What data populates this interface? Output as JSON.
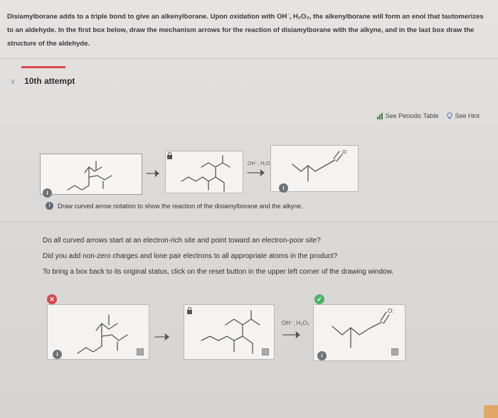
{
  "question": {
    "lead": "Disiamylborane adds to a triple bond to give an alkenylborane. Upon oxidation with OH",
    "sup": "−",
    "mid": ", H₂O₂, the alkenylborane will form an enol that tautomerizes",
    "line2": "to an aldehyde. In the first box below, draw the mechanism arrows for the reaction of disiamylborane with the alkyne, and in the last box draw the",
    "line3": "structure of the aldehyde."
  },
  "attempt": {
    "label": "10th attempt"
  },
  "tools": {
    "periodic_table": "See Periodic Table",
    "hint": "See Hint"
  },
  "upper_row": {
    "reagent": "OH⁻, H₂O₂",
    "oxygen_label": "O:",
    "hint_text": "Draw curved arrow notation to show the reaction of the disiamylborane and the alkyne."
  },
  "feedback": {
    "line1": "Do all curved arrows start at an electron-rich site and point toward an electron-poor site?",
    "line2": "Did you add non-zero charges and lone pair electrons to all appropriate atoms in the product?",
    "line3": "To bring a box back to its original status, click on the reset button in the upper left corner of the drawing window."
  },
  "lower_row": {
    "reagent": "OH⁻, H₂O₂",
    "oxygen_label": "O:"
  },
  "icons": {
    "chevron": "chevron-down-icon",
    "periodic": "bar-chart-icon",
    "hint": "lightbulb-icon",
    "error": "x-icon",
    "success": "check-icon",
    "lock": "lock-icon",
    "info": "info-icon"
  },
  "colors": {
    "error": "#d9474d",
    "success": "#4fb26a",
    "accent_bar": "#e0474c"
  }
}
